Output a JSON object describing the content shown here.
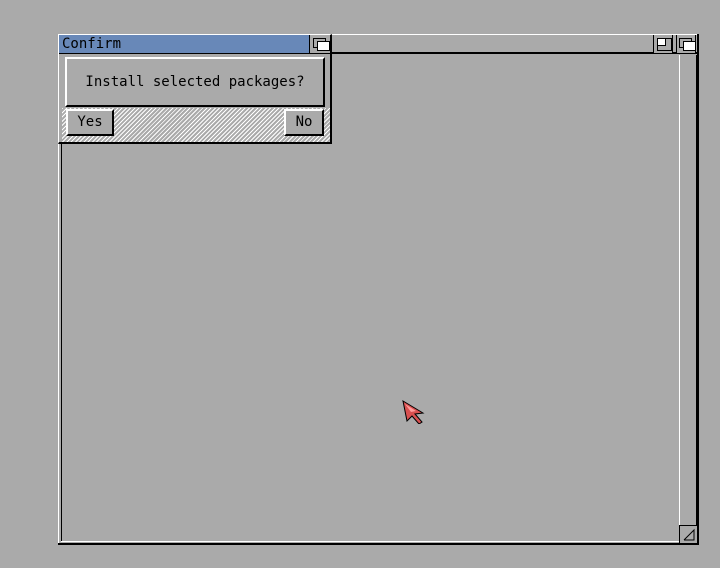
{
  "dialog": {
    "title": "Confirm",
    "message": "Install selected packages?",
    "yes_label": "Yes",
    "no_label": "No",
    "title_bar_color": "#6888b8"
  },
  "icons": {
    "dialog_depth": "depth-arrange-icon",
    "window_zoom": "zoom-icon",
    "window_depth": "depth-arrange-icon",
    "window_size": "resize-icon",
    "pointer": "mouse-pointer-icon"
  },
  "colors": {
    "background": "#aaaaaa",
    "shine": "#ffffff",
    "shadow": "#000000",
    "pointer": "#e05050"
  }
}
